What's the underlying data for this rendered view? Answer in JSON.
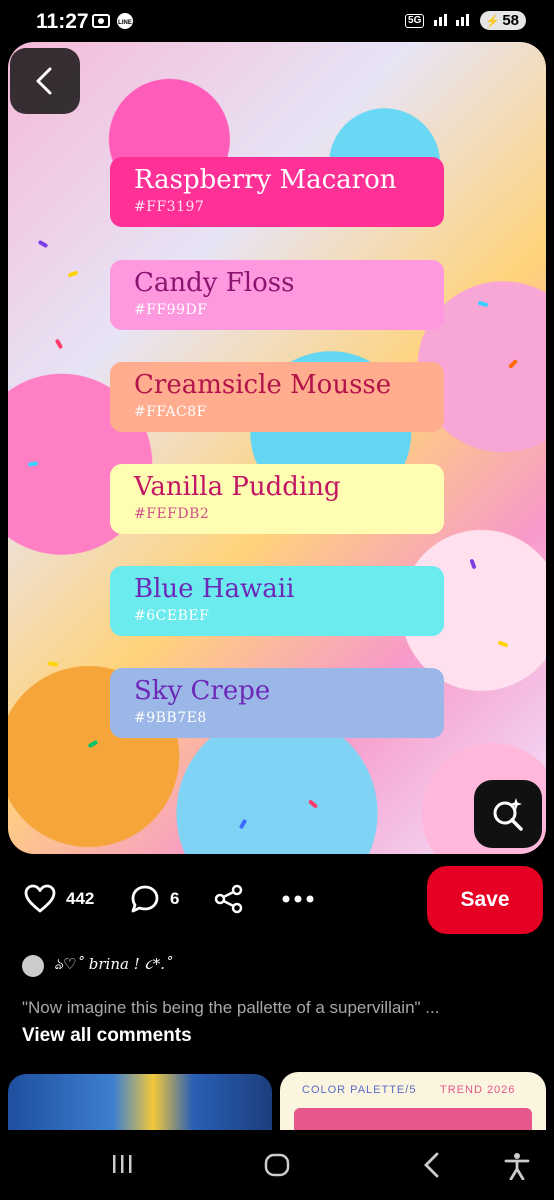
{
  "status_bar": {
    "time": "11:27",
    "network": "5G",
    "battery": "58"
  },
  "palette": [
    {
      "name": "Raspberry Macaron",
      "hex": "#FF3197",
      "bg": "#ff3197",
      "fg": "#ffffff",
      "hexColor": "#ffe1ef"
    },
    {
      "name": "Candy Floss",
      "hex": "#FF99DF",
      "bg": "#ff99df",
      "fg": "#8a1470",
      "hexColor": "#ffffff"
    },
    {
      "name": "Creamsicle Mousse",
      "hex": "#FFAC8F",
      "bg": "#ffac8f",
      "fg": "#b3124a",
      "hexColor": "#ffffff"
    },
    {
      "name": "Vanilla Pudding",
      "hex": "#FEFDB2",
      "bg": "#fefdb2",
      "fg": "#c21664",
      "hexColor": "#d05088"
    },
    {
      "name": "Blue Hawaii",
      "hex": "#6CEBEF",
      "bg": "#6cebef",
      "fg": "#6d28b8",
      "hexColor": "#ffffff"
    },
    {
      "name": "Sky Crepe",
      "hex": "#9BB7E8",
      "bg": "#9bb7e8",
      "fg": "#6d28b8",
      "hexColor": "#ffffff"
    }
  ],
  "actions": {
    "likes": "442",
    "comments": "6",
    "save_label": "Save"
  },
  "author": {
    "name": "ঌ♡˚ brina ! ૮*.˚"
  },
  "comment": {
    "text": "\"Now imagine this being the pallette of a supervillain\" ...",
    "view_all": "View all comments"
  },
  "related": {
    "label_left": "COLOR PALETTE/5",
    "label_right": "TREND 2026"
  }
}
